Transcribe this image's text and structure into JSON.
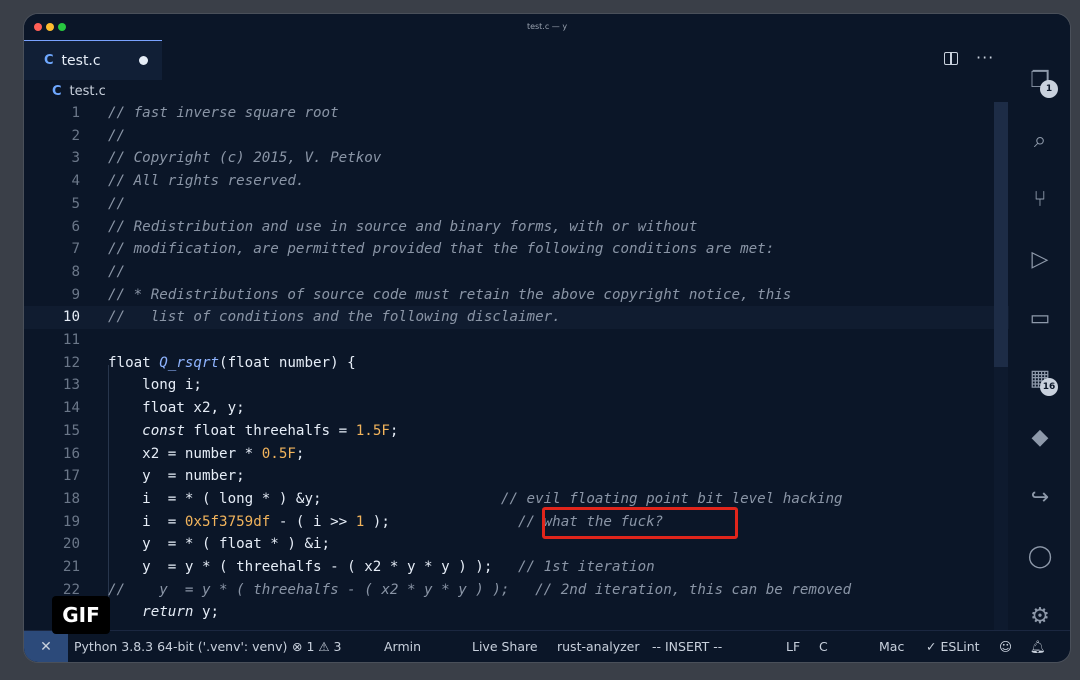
{
  "window": {
    "title": "test.c — y"
  },
  "tab": {
    "icon": "c-file-icon",
    "icon_glyph": "C",
    "label": "test.c",
    "modified": true
  },
  "editor_actions": {
    "split": "split-editor-icon",
    "more": "···"
  },
  "breadcrumb": {
    "icon_glyph": "C",
    "file": "test.c"
  },
  "editor": {
    "active_line": 10,
    "lines": [
      {
        "n": "1",
        "tokens": [
          {
            "t": "// fast inverse square root",
            "c": "cm"
          }
        ]
      },
      {
        "n": "2",
        "tokens": [
          {
            "t": "//",
            "c": "cm"
          }
        ]
      },
      {
        "n": "3",
        "tokens": [
          {
            "t": "// Copyright (c) 2015, V. Petkov",
            "c": "cm"
          }
        ]
      },
      {
        "n": "4",
        "tokens": [
          {
            "t": "// All rights reserved.",
            "c": "cm"
          }
        ]
      },
      {
        "n": "5",
        "tokens": [
          {
            "t": "//",
            "c": "cm"
          }
        ]
      },
      {
        "n": "6",
        "tokens": [
          {
            "t": "// Redistribution and use in source and binary forms, with or without",
            "c": "cm"
          }
        ]
      },
      {
        "n": "7",
        "tokens": [
          {
            "t": "// modification, are permitted provided that the following conditions are met:",
            "c": "cm"
          }
        ]
      },
      {
        "n": "8",
        "tokens": [
          {
            "t": "//",
            "c": "cm"
          }
        ]
      },
      {
        "n": "9",
        "tokens": [
          {
            "t": "// * Redistributions of source code must retain the above copyright notice, this",
            "c": "cm"
          }
        ]
      },
      {
        "n": "10",
        "tokens": [
          {
            "t": "//   list of conditions and the following disclaimer.",
            "c": "cm"
          }
        ]
      },
      {
        "n": "11",
        "tokens": []
      },
      {
        "n": "12",
        "tokens": [
          {
            "t": "float ",
            "c": "kw"
          },
          {
            "t": "Q_rsqrt",
            "c": "fn"
          },
          {
            "t": "(float number) {",
            "c": "kw"
          }
        ]
      },
      {
        "n": "13",
        "tokens": [
          {
            "t": "    long i;",
            "c": "kw"
          }
        ]
      },
      {
        "n": "14",
        "tokens": [
          {
            "t": "    float x2, y;",
            "c": "kw"
          }
        ]
      },
      {
        "n": "15",
        "tokens": [
          {
            "t": "    ",
            "c": "kw"
          },
          {
            "t": "const",
            "c": "it"
          },
          {
            "t": " float threehalfs = ",
            "c": "kw"
          },
          {
            "t": "1.5F",
            "c": "num"
          },
          {
            "t": ";",
            "c": "kw"
          }
        ]
      },
      {
        "n": "16",
        "tokens": [
          {
            "t": "    x2 = number * ",
            "c": "kw"
          },
          {
            "t": "0.5F",
            "c": "num"
          },
          {
            "t": ";",
            "c": "kw"
          }
        ]
      },
      {
        "n": "17",
        "tokens": [
          {
            "t": "    y  = number;",
            "c": "kw"
          }
        ]
      },
      {
        "n": "18",
        "tokens": [
          {
            "t": "    i  = * ( long * ) &y;                     ",
            "c": "kw"
          },
          {
            "t": "// evil floating point bit level hacking",
            "c": "cm"
          }
        ]
      },
      {
        "n": "19",
        "tokens": [
          {
            "t": "    i  = ",
            "c": "kw"
          },
          {
            "t": "0x5f3759df",
            "c": "num"
          },
          {
            "t": " - ( i >> ",
            "c": "kw"
          },
          {
            "t": "1",
            "c": "num"
          },
          {
            "t": " );               ",
            "c": "kw"
          },
          {
            "t": "// what the fuck?",
            "c": "cm"
          }
        ]
      },
      {
        "n": "20",
        "tokens": [
          {
            "t": "    y  = * ( float * ) &i;",
            "c": "kw"
          }
        ]
      },
      {
        "n": "21",
        "tokens": [
          {
            "t": "    y  = y * ( threehalfs - ( x2 * y * y ) );   ",
            "c": "kw"
          },
          {
            "t": "// 1st iteration",
            "c": "cm"
          }
        ]
      },
      {
        "n": "22",
        "tokens": [
          {
            "t": "//    y  = y * ( threehalfs - ( x2 * y * y ) );   // 2nd iteration, this can be removed",
            "c": "cm"
          }
        ]
      },
      {
        "n": "",
        "tokens": [
          {
            "t": "    ",
            "c": "kw"
          },
          {
            "t": "return",
            "c": "it"
          },
          {
            "t": " y;",
            "c": "kw"
          }
        ]
      }
    ]
  },
  "activity_bar": [
    {
      "name": "explorer-icon",
      "glyph": "❐",
      "badge": "1"
    },
    {
      "name": "search-icon",
      "glyph": "⌕",
      "badge": ""
    },
    {
      "name": "source-control-icon",
      "glyph": "⑂",
      "badge": ""
    },
    {
      "name": "run-debug-icon",
      "glyph": "▷",
      "badge": ""
    },
    {
      "name": "remote-explorer-icon",
      "glyph": "▭",
      "badge": ""
    },
    {
      "name": "extensions-icon",
      "glyph": "▦",
      "badge": "16"
    },
    {
      "name": "docker-icon",
      "glyph": "◆",
      "badge": ""
    },
    {
      "name": "live-share-icon",
      "glyph": "↪",
      "badge": ""
    },
    {
      "name": "account-icon",
      "glyph": "◯",
      "badge": ""
    },
    {
      "name": "settings-gear-icon",
      "glyph": "⚙",
      "badge": ""
    }
  ],
  "statusbar": {
    "remote_glyph": "✕",
    "python": "Python 3.8.3 64-bit ('.venv': venv)",
    "problems": "⊗ 1 ⚠ 3",
    "user": "Armin",
    "live_share": "Live Share",
    "analyzer": "rust-analyzer",
    "mode": "-- INSERT --",
    "eol": "LF",
    "language": "C",
    "os": "Mac",
    "eslint": "✓ ESLint"
  },
  "overlay": {
    "gif_label": "GIF"
  },
  "colors": {
    "highlight_box": "#e1251b",
    "accent": "#7aa2ff"
  }
}
